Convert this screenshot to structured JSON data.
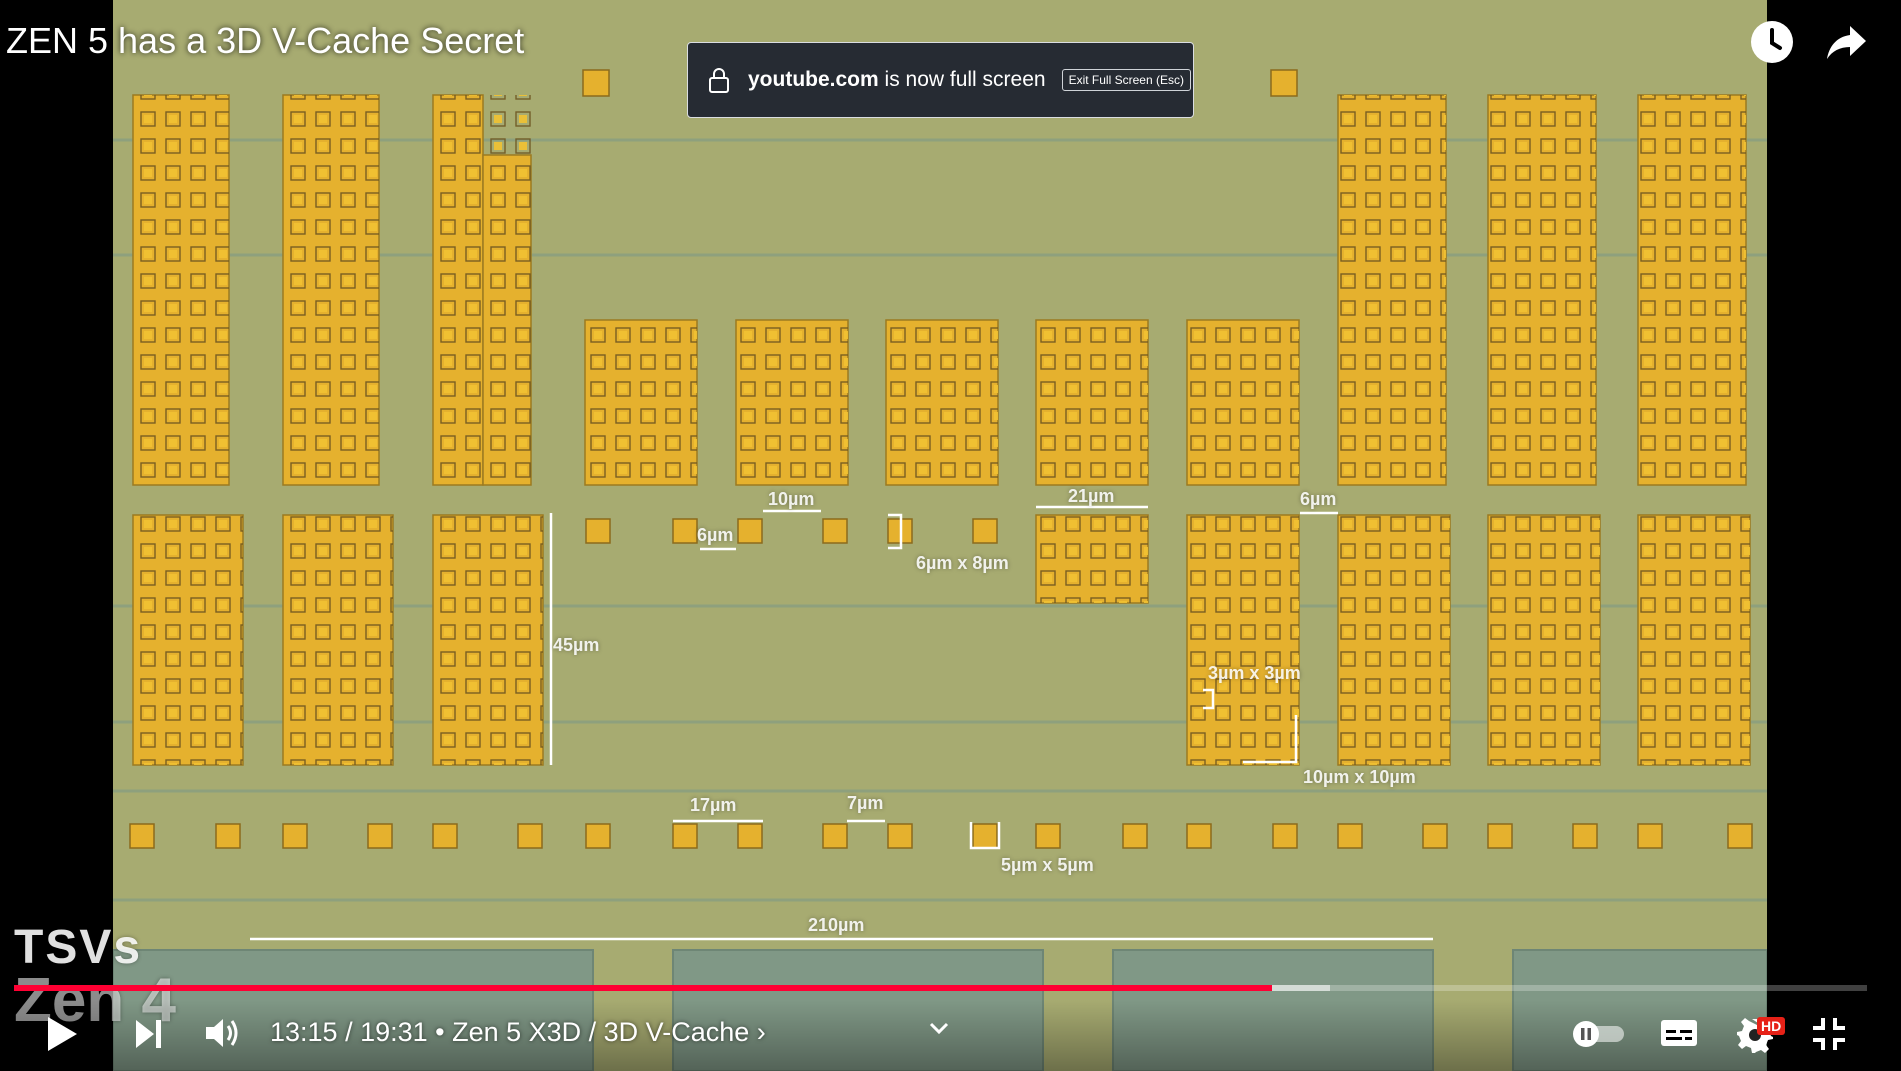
{
  "video": {
    "title": "ZEN 5 has a 3D V-Cache Secret",
    "measurements": [
      {
        "id": "m45",
        "text": "45µm"
      },
      {
        "id": "m10",
        "text": "10µm"
      },
      {
        "id": "m6a",
        "text": "6µm"
      },
      {
        "id": "m6x8",
        "text": "6µm x 8µm"
      },
      {
        "id": "m21",
        "text": "21µm"
      },
      {
        "id": "m6b",
        "text": "6µm"
      },
      {
        "id": "m3x3",
        "text": "3µm x 3µm"
      },
      {
        "id": "m10x10",
        "text": "10µm x 10µm"
      },
      {
        "id": "m17",
        "text": "17µm"
      },
      {
        "id": "m7",
        "text": "7µm"
      },
      {
        "id": "m5x5",
        "text": "5µm x 5µm"
      },
      {
        "id": "m210",
        "text": "210µm"
      }
    ],
    "overlay_tsvs": "TSVs",
    "overlay_zen4": "Zen 4"
  },
  "top_bar": {
    "watch_later_icon": "clock-icon",
    "share_icon": "share-arrow-icon"
  },
  "fullscreen_toast": {
    "domain": "youtube.com",
    "message": " is now full screen",
    "exit_label": "Exit Full Screen (Esc)",
    "lock_icon": "lock-icon"
  },
  "player": {
    "current_time": "13:15",
    "duration": "19:31",
    "chapter": "Zen 5 X3D / 3D V-Cache",
    "time_display": "13:15 / 19:31 • Zen 5 X3D / 3D V-Cache ›",
    "hd_badge": "HD",
    "played_fraction": 0.679,
    "buffered_fraction": 0.71,
    "colors": {
      "played": "#ff0033",
      "buffered": "rgba(255,255,255,0.55)",
      "track": "rgba(255,255,255,0.25)"
    },
    "icons": {
      "play": "play-icon",
      "next": "next-icon",
      "volume": "volume-icon",
      "chapter_expand": "chevron-down-icon",
      "autoplay": "autoplay-toggle-icon",
      "subtitles": "subtitles-icon",
      "settings": "gear-icon",
      "exit_fullscreen": "exit-fullscreen-icon"
    }
  }
}
